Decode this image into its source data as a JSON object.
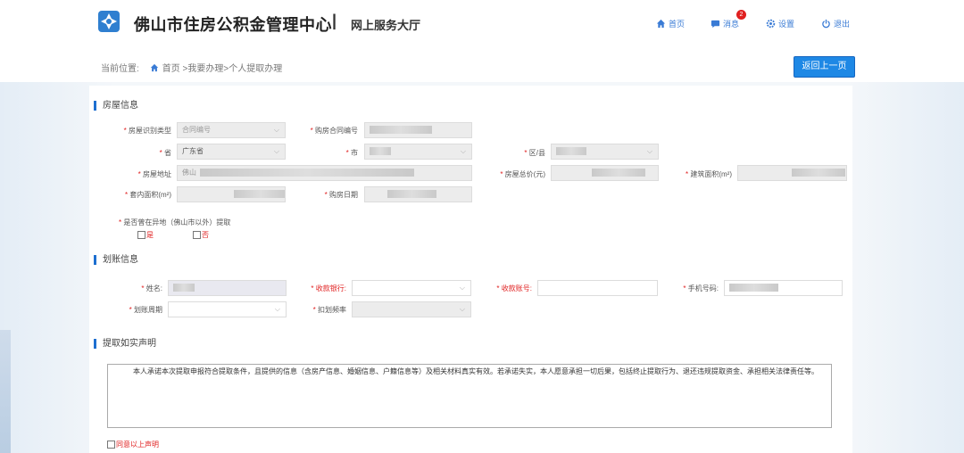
{
  "header": {
    "org_title": "佛山市住房公积金管理中心",
    "separator": "|",
    "hall_title": "网上服务大厅",
    "nav": [
      {
        "label": "首页",
        "icon": "home-icon"
      },
      {
        "label": "消息",
        "icon": "chat-icon",
        "badge": "2"
      },
      {
        "label": "设置",
        "icon": "gear-icon"
      },
      {
        "label": "退出",
        "icon": "power-icon"
      }
    ]
  },
  "breadcrumb": {
    "prefix": "当前位置:",
    "path": "首页 >我要办理>个人提取办理"
  },
  "back_button": "返回上一页",
  "house_section": {
    "title": "房屋信息",
    "house_id_type_label": "房屋识别类型",
    "house_id_type_value": "合同编号",
    "contract_no_label": "购房合同编号",
    "province_label": "省",
    "province_value": "广东省",
    "city_label": "市",
    "district_label": "区/县",
    "address_label": "房屋地址",
    "address_prefix": "佛山",
    "total_price_label": "房屋总价(元)",
    "building_area_label": "建筑面积(m²)",
    "inner_area_label": "套内面积(m²)",
    "purchase_date_label": "购房日期",
    "offsite_question": "是否曾在异地（佛山市以外）提取",
    "yes_label": "是",
    "no_label": "否"
  },
  "transfer_section": {
    "title": "划账信息",
    "name_label": "姓名:",
    "bank_label": "收款银行:",
    "account_label": "收款账号:",
    "phone_label": "手机号码:",
    "period_label": "划账周期",
    "frequency_label": "扣划频率"
  },
  "declaration_section": {
    "title": "提取如实声明",
    "text": "本人承诺本次提取申报符合提取条件，且提供的信息（含房产信息、婚姻信息、户籍信息等）及相关材料真实有效。若承诺失实，本人愿意承担一切后果，包括终止提取行为、退还违规提取资金、承担相关法律责任等。",
    "agree_label": "同意以上声明"
  },
  "colors": {
    "accent": "#1e88e5",
    "section_bar": "#1e6fd0",
    "required": "#e02020",
    "nav": "#3a7bd5"
  }
}
